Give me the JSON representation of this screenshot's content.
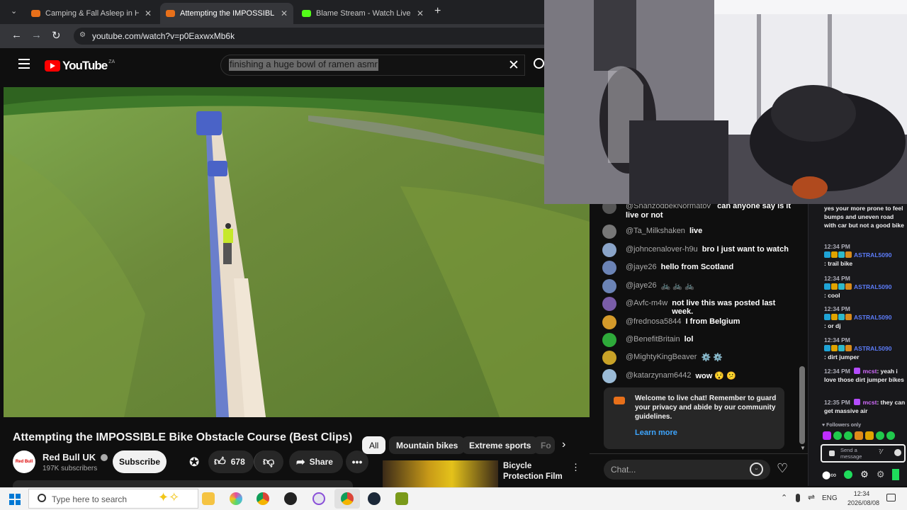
{
  "browser": {
    "tabs": [
      {
        "label": "Camping & Fall Asleep in H",
        "favicon_color": "#e8701a"
      },
      {
        "label": "Attempting the IMPOSSIBLE",
        "favicon_color": "#e8701a"
      },
      {
        "label": "Blame Stream - Watch Live on K",
        "favicon_color": "#53fc18"
      }
    ],
    "url": "youtube.com/watch?v=p0EaxwxMb6k"
  },
  "youtube": {
    "logo_text": "YouTube",
    "region": "ZA",
    "search_value": "finishing a huge bowl of ramen asmr",
    "video_title": "Attempting the IMPOSSIBLE Bike Obstacle Course (Best Clips)",
    "channel_name": "Red Bull UK",
    "avatar_text": "Red Bull",
    "subscribers": "197K subscribers",
    "subscribe_label": "Subscribe",
    "like_count": "678",
    "share_label": "Share",
    "chips": [
      "All",
      "Mountain bikes",
      "Extreme sports",
      "Fo"
    ],
    "related": {
      "title": "Bicycle Protection Film"
    }
  },
  "live_chat": {
    "messages": [
      {
        "author": "@ShahzodbekNormatov",
        "text": "can anyone say is it live or not",
        "avatar_color": "#555"
      },
      {
        "author": "@Ta_Milkshaken",
        "text": "live",
        "avatar_color": "#777"
      },
      {
        "author": "@johncenalover-h9u",
        "text": "bro I just want to watch",
        "avatar_color": "#8aa4c8"
      },
      {
        "author": "@jaye26",
        "text": "hello from Scotland",
        "avatar_color": "#6b83b5"
      },
      {
        "author": "@jaye26",
        "text": "🚲 🚲 🚲",
        "avatar_color": "#6b83b5"
      },
      {
        "author": "@Avfc-m4w",
        "text": "not live this was posted last week.",
        "avatar_color": "#7a5da8"
      },
      {
        "author": "@frednosa5844",
        "text": "I from Belgium",
        "avatar_color": "#d49a2a"
      },
      {
        "author": "@BenefitBritain",
        "text": "lol",
        "avatar_color": "#2eaa3a"
      },
      {
        "author": "@MightyKingBeaver",
        "text": "⚙️ ⚙️",
        "avatar_color": "#c9a227"
      },
      {
        "author": "@katarzynam6442",
        "text": "wow 😯 😕",
        "avatar_color": "#9bbbd6"
      }
    ],
    "welcome_text": "Welcome to live chat! Remember to guard your privacy and abide by our community guidelines.",
    "learn_more": "Learn more",
    "input_placeholder": "Chat..."
  },
  "twitch_chat": {
    "top_message": "yes your more prone to feel bumps and uneven road with car but not a good bike",
    "messages": [
      {
        "time": "12:34 PM",
        "user": "ASTRAL5090",
        "text": ": trail bike"
      },
      {
        "time": "12:34 PM",
        "user": "ASTRAL5090",
        "text": ": cool"
      },
      {
        "time": "12:34 PM",
        "user": "ASTRAL5090",
        "text": ": or dj"
      },
      {
        "time": "12:34 PM",
        "user": "ASTRAL5090",
        "text": ": dirt jumper"
      },
      {
        "time": "12:34 PM",
        "user": "mcst",
        "text": ": yeah i love those dirt jumper bikes"
      },
      {
        "time": "12:35 PM",
        "user": "mcst",
        "text": ": they can get massive air"
      }
    ],
    "followers_only": "Followers only",
    "send_placeholder": "Send a message"
  },
  "taskbar": {
    "search_placeholder": "Type here to search",
    "language": "ENG",
    "time": "12:34",
    "date": "2026/08/08"
  }
}
